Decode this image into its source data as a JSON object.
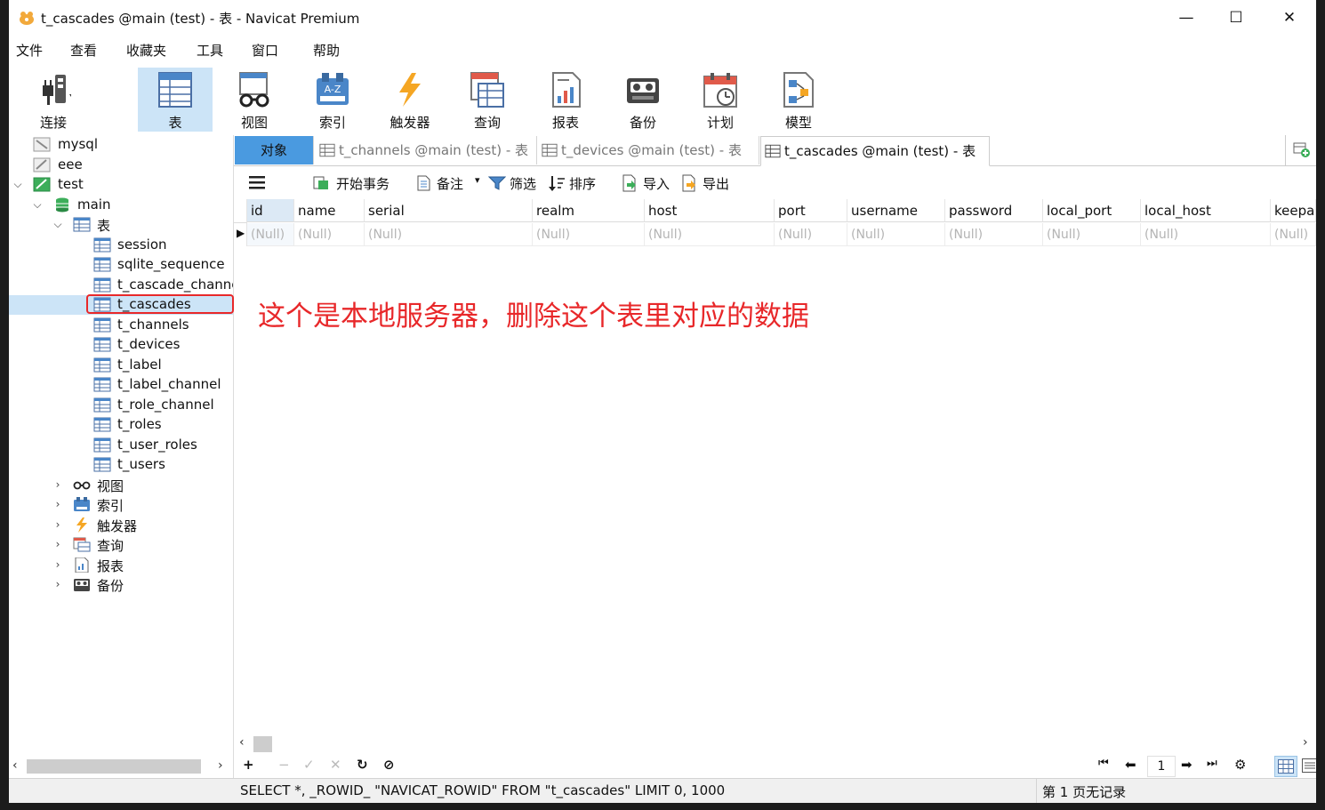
{
  "window": {
    "title": "t_cascades @main (test) - 表 - Navicat Premium",
    "controls": {
      "minimize": "—",
      "maximize": "☐",
      "close": "✕"
    }
  },
  "menu": [
    "文件",
    "查看",
    "收藏夹",
    "工具",
    "窗口",
    "帮助"
  ],
  "toolbar": [
    {
      "label": "连接",
      "icon": "plug-icon"
    },
    {
      "label": "表",
      "icon": "table-icon",
      "active": true
    },
    {
      "label": "视图",
      "icon": "glasses-icon"
    },
    {
      "label": "索引",
      "icon": "index-icon"
    },
    {
      "label": "触发器",
      "icon": "lightning-icon"
    },
    {
      "label": "查询",
      "icon": "query-icon"
    },
    {
      "label": "报表",
      "icon": "report-icon"
    },
    {
      "label": "备份",
      "icon": "backup-icon"
    },
    {
      "label": "计划",
      "icon": "calendar-clock-icon"
    },
    {
      "label": "模型",
      "icon": "model-icon"
    }
  ],
  "tree": {
    "connections": [
      {
        "name": "mysql"
      },
      {
        "name": "eee"
      },
      {
        "name": "test"
      }
    ],
    "database": "main",
    "tables_label": "表",
    "tables": [
      "session",
      "sqlite_sequence",
      "t_cascade_channe",
      "t_cascades",
      "t_channels",
      "t_devices",
      "t_label",
      "t_label_channel",
      "t_role_channel",
      "t_roles",
      "t_user_roles",
      "t_users"
    ],
    "selected_table": "t_cascades",
    "groups": [
      "视图",
      "索引",
      "触发器",
      "查询",
      "报表",
      "备份"
    ]
  },
  "tabs": [
    {
      "label": "对象"
    },
    {
      "label": "t_channels @main (test) - 表"
    },
    {
      "label": "t_devices @main (test) - 表"
    },
    {
      "label": "t_cascades @main (test) - 表"
    }
  ],
  "object_toolbar": {
    "begin_transaction": "开始事务",
    "memo": "备注",
    "filter": "筛选",
    "sort": "排序",
    "import": "导入",
    "export": "导出"
  },
  "grid": {
    "columns": [
      "id",
      "name",
      "serial",
      "realm",
      "host",
      "port",
      "username",
      "password",
      "local_port",
      "local_host",
      "keepa"
    ],
    "rows": [
      [
        "(Null)",
        "(Null)",
        "(Null)",
        "(Null)",
        "(Null)",
        "(Null)",
        "(Null)",
        "(Null)",
        "(Null)",
        "(Null)",
        "(Null)"
      ]
    ]
  },
  "record_nav": {
    "page": "1"
  },
  "status": {
    "sql": "SELECT *, _ROWID_ \"NAVICAT_ROWID\" FROM \"t_cascades\" LIMIT 0, 1000",
    "records": "第 1 页无记录"
  },
  "annotation": {
    "text": "这个是本地服务器，删除这个表里对应的数据",
    "color": "#e8282a"
  }
}
